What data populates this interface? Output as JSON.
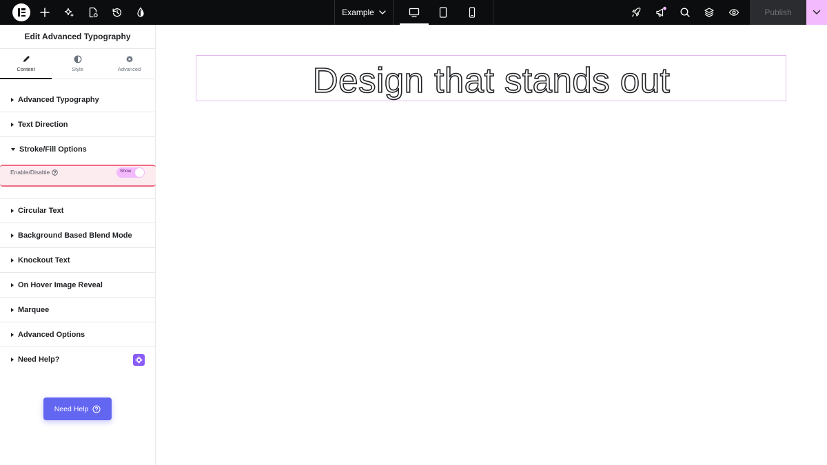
{
  "topbar": {
    "logo_icon": "elementor-logo-icon",
    "left_icons": [
      "add-icon",
      "ai-sparkle-icon",
      "page-settings-icon",
      "history-icon",
      "site-settings-drop-icon"
    ],
    "document_name": "Example",
    "devices": [
      {
        "name": "desktop",
        "active": true
      },
      {
        "name": "tablet",
        "active": false
      },
      {
        "name": "mobile",
        "active": false
      }
    ],
    "right_icons": [
      "rocket-icon",
      "announcements-icon",
      "search-icon",
      "structure-layers-icon",
      "preview-eye-icon"
    ],
    "publish_label": "Publish",
    "notification_dot_color": "#f3bafd"
  },
  "panel": {
    "title": "Edit Advanced Typography",
    "tabs": [
      {
        "label": "Content",
        "icon": "pencil-icon",
        "active": true
      },
      {
        "label": "Style",
        "icon": "half-circle-icon",
        "active": false
      },
      {
        "label": "Advanced",
        "icon": "gear-icon",
        "active": false
      }
    ],
    "sections": [
      {
        "label": "Advanced Typography",
        "expanded": false
      },
      {
        "label": "Text Direction",
        "expanded": false
      },
      {
        "label": "Stroke/Fill Options",
        "expanded": true
      },
      {
        "label": "Circular Text",
        "expanded": false
      },
      {
        "label": "Background Based Blend Mode",
        "expanded": false
      },
      {
        "label": "Knockout Text",
        "expanded": false
      },
      {
        "label": "On Hover Image Reveal",
        "expanded": false
      },
      {
        "label": "Marquee",
        "expanded": false
      },
      {
        "label": "Advanced Options",
        "expanded": false
      },
      {
        "label": "Need Help?",
        "expanded": false
      }
    ],
    "toggle": {
      "label": "Enable/Disable",
      "state_label": "Show",
      "enabled": true
    },
    "need_help_button": "Need Help"
  },
  "canvas": {
    "headline": "Design that stands out"
  },
  "colors": {
    "topbar_bg": "#0c0d0e",
    "accent_pink": "#f3bafd",
    "highlight_red": "#ef6a80",
    "help_button": "#6366f1"
  }
}
